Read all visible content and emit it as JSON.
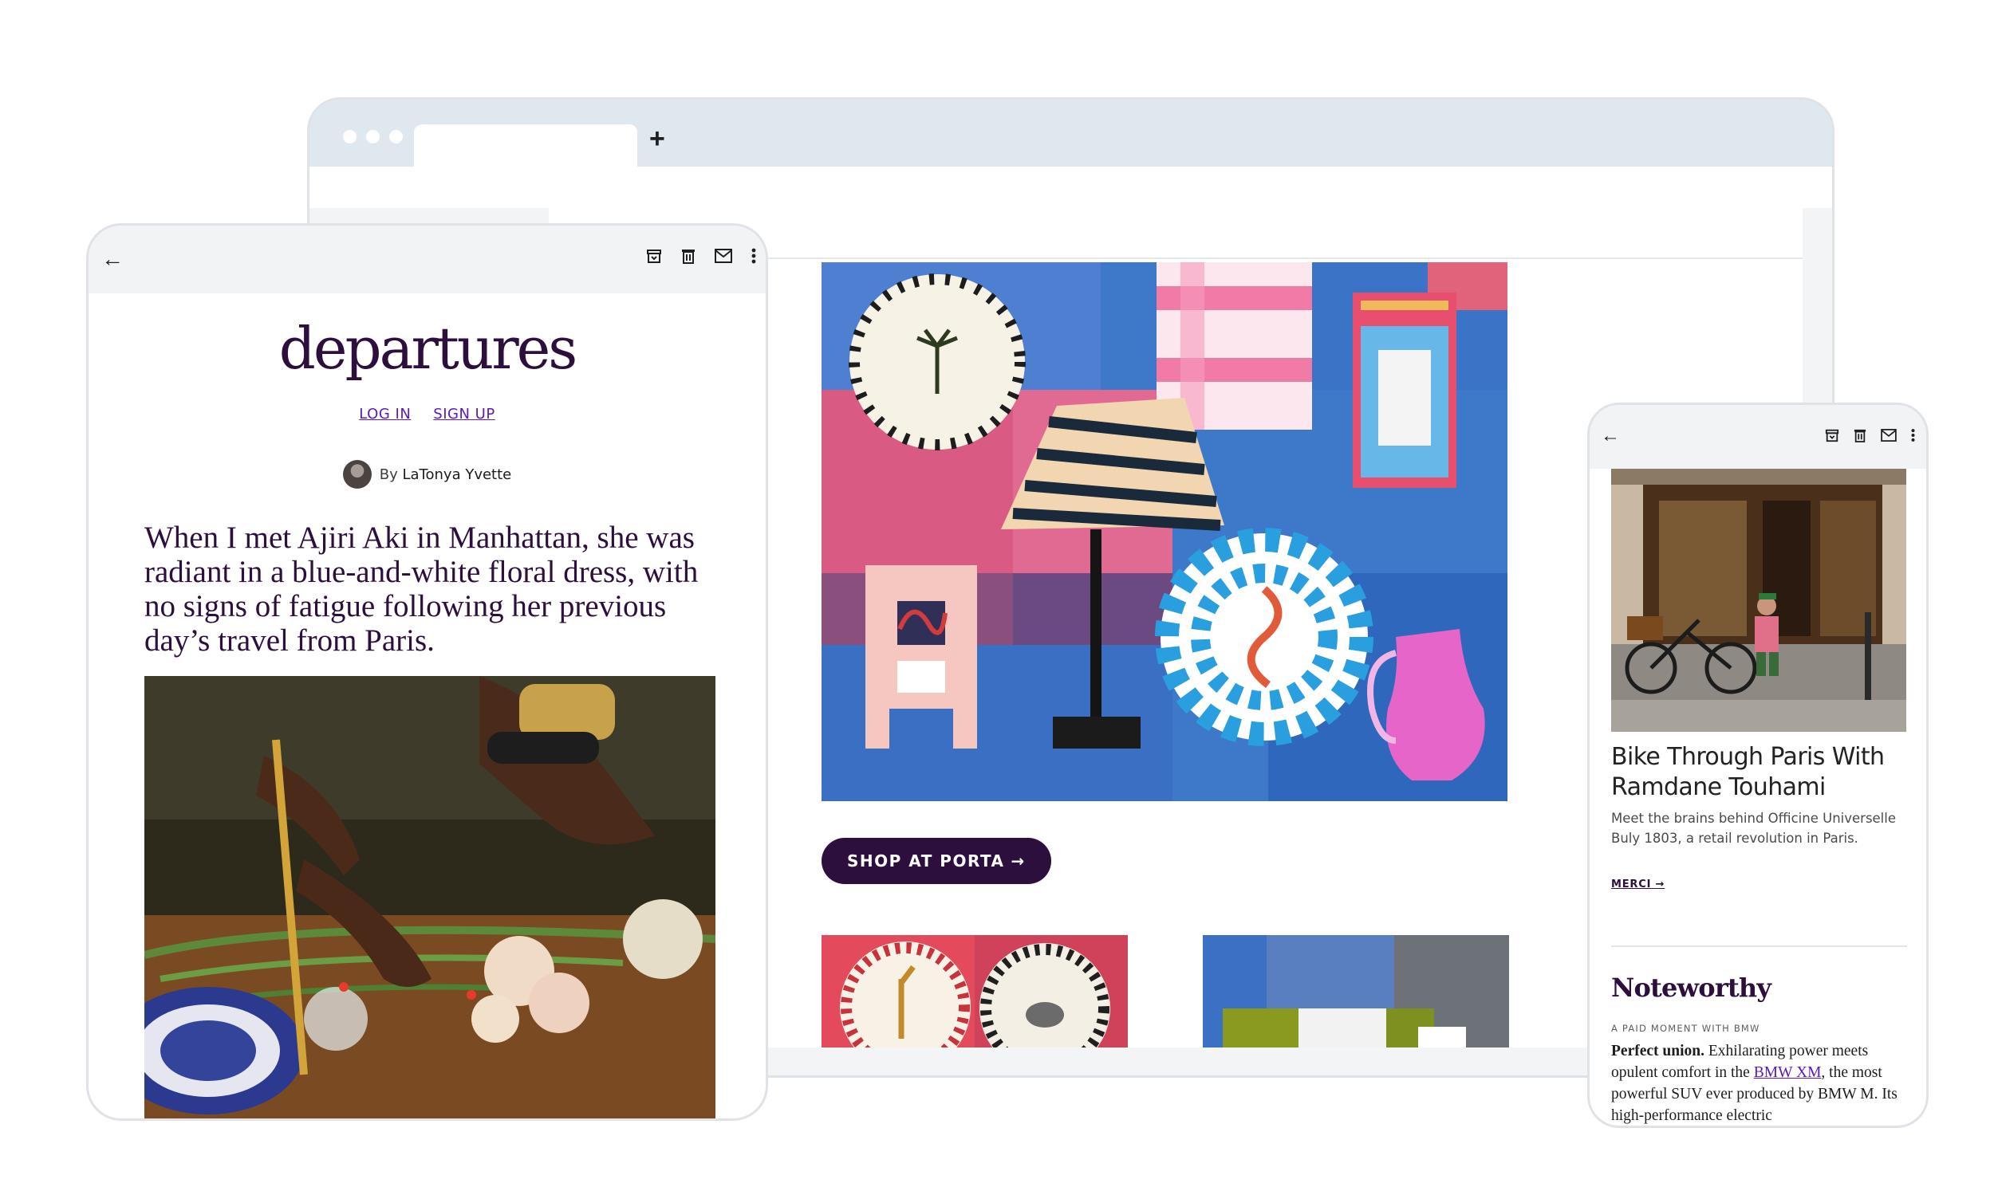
{
  "browser": {
    "new_tab_symbol": "+",
    "shop_button": {
      "label": "SHOP AT PORTA",
      "arrow": "→"
    }
  },
  "tablet": {
    "logo": "departures",
    "login_label": "LOG IN",
    "signup_label": "SIGN UP",
    "byline_prefix": "By",
    "author": "LaTonya Yvette",
    "lede": "When I met Ajiri Aki in Manhattan, she was radiant in a blue-and-white floral dress, with no signs of fatigue following her previous day’s travel from Paris."
  },
  "phone": {
    "article_title": "Bike Through Paris With Ramdane Touhami",
    "article_desc": "Meet the brains behind Officine Universelle Buly 1803, a retail revolution in Paris.",
    "merci_label": "MERCI",
    "merci_arrow": "→",
    "section_title": "Noteworthy",
    "paid_label": "A PAID MOMENT WITH BMW",
    "body_bold": "Perfect union.",
    "body_part1": " Exhilarating power meets opulent comfort in the ",
    "body_link": "BMW XM",
    "body_part2": ", the most powerful SUV ever produced by BMW M. Its high-performance electric"
  },
  "colors": {
    "brand": "#2c0f3d",
    "link": "#5a16c7",
    "toolbar": "#f1f3f4",
    "browser_chrome": "#dfe7ef"
  },
  "icons": [
    "back-arrow-icon",
    "archive-icon",
    "trash-icon",
    "mail-icon",
    "more-vert-icon"
  ]
}
